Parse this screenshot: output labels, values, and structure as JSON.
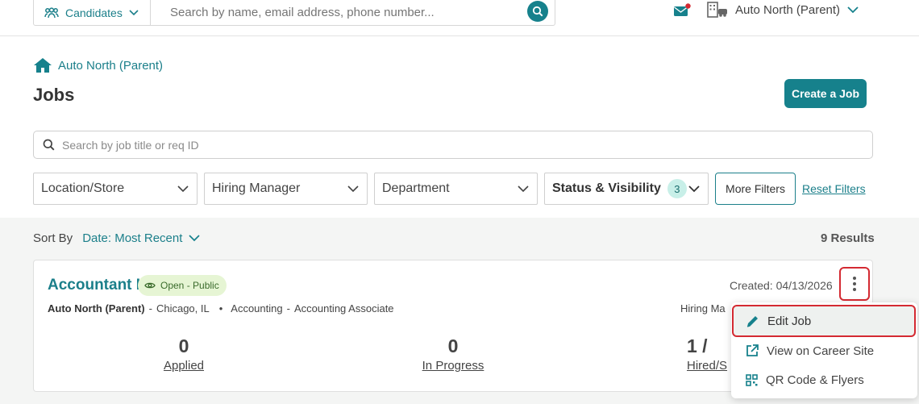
{
  "topbar": {
    "candidates_label": "Candidates",
    "search_placeholder": "Search by name, email address, phone number...",
    "org_name": "Auto North (Parent)"
  },
  "header": {
    "breadcrumb": "Auto North (Parent)",
    "title": "Jobs",
    "create_button": "Create a Job"
  },
  "job_search": {
    "placeholder": "Search by job title or req ID"
  },
  "filters": {
    "location": "Location/Store",
    "hiring_manager": "Hiring Manager",
    "department": "Department",
    "status": "Status & Visibility",
    "status_count": "3",
    "more": "More Filters",
    "reset": "Reset Filters"
  },
  "sort": {
    "label": "Sort By",
    "value": "Date: Most Recent"
  },
  "results": "9 Results",
  "job": {
    "title": "Accountant I",
    "status": "Open - Public",
    "org": "Auto North (Parent)",
    "location": "Chicago, IL",
    "department": "Accounting",
    "role": "Accounting Associate",
    "created": "Created: 04/13/2026",
    "hiring_manager_partial": "Hiring Ma",
    "stats": [
      {
        "num": "0",
        "label": "Applied"
      },
      {
        "num": "0",
        "label": "In Progress"
      },
      {
        "num": "1 / ",
        "label": "Hired/S"
      }
    ]
  },
  "menu": {
    "items": [
      {
        "label": "Edit Job",
        "icon": "pencil-icon"
      },
      {
        "label": "View on Career Site",
        "icon": "external-link-icon"
      },
      {
        "label": "QR Code & Flyers",
        "icon": "qr-code-icon"
      }
    ]
  },
  "colors": {
    "accent": "#16818c",
    "highlight": "#d42a32",
    "pill_bg": "#e6f5d4"
  }
}
